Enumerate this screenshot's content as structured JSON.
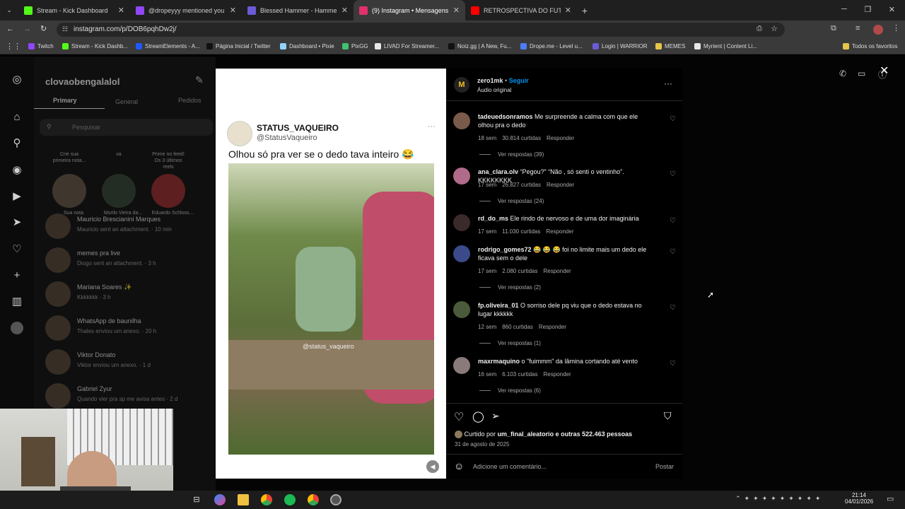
{
  "tabs": [
    {
      "title": "Stream - Kick Dashboard",
      "color": "#53fc18"
    },
    {
      "title": "@dropeyyy mentioned you",
      "color": "#9146ff"
    },
    {
      "title": "Blessed Hammer - Hammerkun",
      "color": "#6b5bd6"
    },
    {
      "title": "(9) Instagram • Mensagens",
      "color": "#e1306c"
    },
    {
      "title": "RETROSPECTIVA DO FUTEBOL 2",
      "color": "#ff0000"
    }
  ],
  "url": "instagram.com/p/DOB6pqhDw2j/",
  "bookmarks": [
    "Twitch",
    "Stream - Kick Dashb...",
    "StreamElements - A...",
    "Página Inicial / Twitter",
    "Dashboard • Pixie",
    "PixGG",
    "LIVAD For Streamer...",
    "Noiz.gg | A New, Fu...",
    "Drope.me - Level u...",
    "Login | WARRIOR",
    "MEMES",
    "Myrient | Content Li...",
    "Todos os favoritos"
  ],
  "dm": {
    "username": "clovaobengalalol",
    "tabs": [
      "Primary",
      "General",
      "Pedidos"
    ],
    "search_placeholder": "Pesquisar",
    "notes": [
      {
        "note": "Crie sua primeira nota...",
        "name": "Sua nota"
      },
      {
        "note": "va",
        "name": "Murilo Vieira da..."
      },
      {
        "note": "Prime no feed! Os 3 últimos reels",
        "name": "Eduardo Schloss..."
      }
    ],
    "threads": [
      {
        "name": "Mauricio Brescianini Marques",
        "preview": "Mauricio sent an attachment. · 10 min"
      },
      {
        "name": "memes pra live",
        "preview": "Diogo sent an attachment. · 3 h"
      },
      {
        "name": "Mariana Soares ✨",
        "preview": "Kkkkkkk · 3 h"
      },
      {
        "name": "WhatsApp de baunilha",
        "preview": "Thales enviou um anexo. · 20 h"
      },
      {
        "name": "Viktor Donato",
        "preview": "Viktor enviou um anexo. · 1 d"
      },
      {
        "name": "Gabriel Zyur",
        "preview": "Quando vier pra sp me avisa antes · 2 d"
      }
    ]
  },
  "post": {
    "account_name": "STATUS_VAQUEIRO",
    "account_handle": "@StatusVaqueiro",
    "caption": "Olhou só pra ver se o dedo tava inteiro 😂",
    "watermark": "@status_vaqueiro",
    "author": "zero1mk",
    "follow": "Seguir",
    "audio": "Áudio original",
    "likes_prefix": "Curtido por",
    "likes_user": "um_final_aleatorio",
    "likes_suffix": "e outras 522.463 pessoas",
    "date": "31 de agosto de 2025",
    "comment_placeholder": "Adicione um comentário...",
    "post_button": "Postar"
  },
  "comments": [
    {
      "user": "tadeuedsonramos",
      "text": "Me surpreende a calma com que ele olhou pra o dedo",
      "age": "18 sem",
      "likes": "30.814 curtidas",
      "reply": "Responder",
      "replies": "Ver respostas (39)"
    },
    {
      "user": "ana_clara.olv",
      "text": "“Pegou?” “Não , só senti o ventinho”. KKKKKKKK",
      "age": "17 sem",
      "likes": "26.827 curtidas",
      "reply": "Responder",
      "replies": "Ver respostas (24)"
    },
    {
      "user": "rd_do_ms",
      "text": "Ele rindo de nervoso e de uma dor imaginária",
      "age": "17 sem",
      "likes": "11.030 curtidas",
      "reply": "Responder",
      "replies": ""
    },
    {
      "user": "rodrigo_gomes72",
      "text": "😂 😂 😂 foi no limite mais um dedo ele ficava sem o dele",
      "age": "17 sem",
      "likes": "2.080 curtidas",
      "reply": "Responder",
      "replies": "Ver respostas (2)"
    },
    {
      "user": "fp.oliveira_01",
      "text": "O sorriso dele pq viu que o dedo estava no lugar kkkkkk",
      "age": "12 sem",
      "likes": "860 curtidas",
      "reply": "Responder",
      "replies": "Ver respostas (1)"
    },
    {
      "user": "maxrmaquino",
      "text": "o \"fuimmm\" da lâmina cortando até vento",
      "age": "16 sem",
      "likes": "6.103 curtidas",
      "reply": "Responder",
      "replies": "Ver respostas (6)"
    }
  ],
  "clock": {
    "time": "21:14",
    "date": "04/01/2026"
  }
}
